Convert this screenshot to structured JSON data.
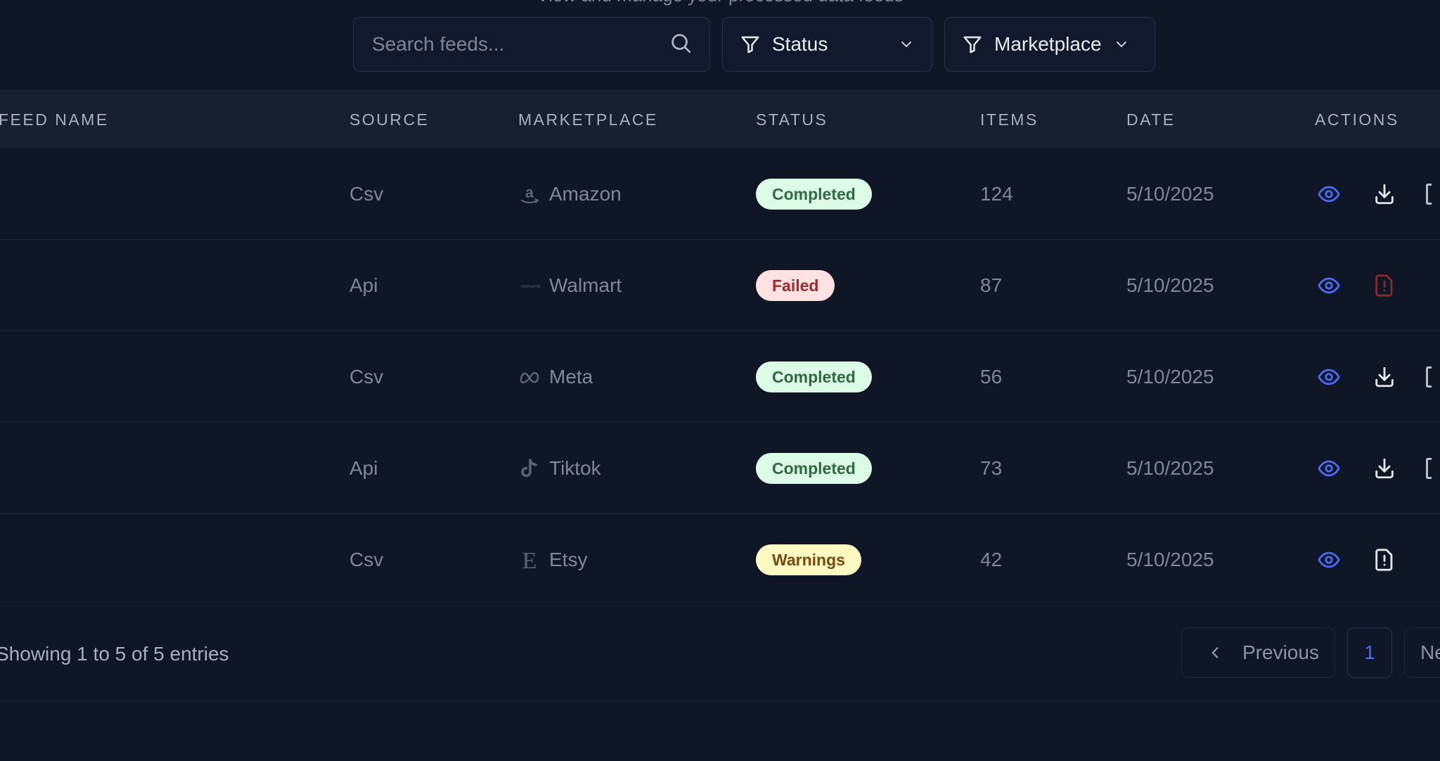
{
  "header": {
    "subtitle": "View and manage your processed data feeds"
  },
  "toolbar": {
    "search_placeholder": "Search feeds...",
    "status_filter": "Status",
    "marketplace_filter": "Marketplace"
  },
  "table": {
    "columns": [
      "FEED NAME",
      "SOURCE",
      "MARKETPLACE",
      "STATUS",
      "ITEMS",
      "DATE",
      "ACTIONS"
    ],
    "rows": [
      {
        "name": "",
        "source": "Csv",
        "marketplace": "Amazon",
        "marketplace_icon": "amazon-icon",
        "status": "Completed",
        "items": "124",
        "date": "5/10/2025",
        "secondary_action": "download"
      },
      {
        "name": "",
        "source": "Api",
        "marketplace": "Walmart",
        "marketplace_icon": "walmart-icon",
        "status": "Failed",
        "items": "87",
        "date": "5/10/2025",
        "secondary_action": "error-report"
      },
      {
        "name": "",
        "source": "Csv",
        "marketplace": "Meta",
        "marketplace_icon": "meta-icon",
        "status": "Completed",
        "items": "56",
        "date": "5/10/2025",
        "secondary_action": "download"
      },
      {
        "name": "",
        "source": "Api",
        "marketplace": "Tiktok",
        "marketplace_icon": "tiktok-icon",
        "status": "Completed",
        "items": "73",
        "date": "5/10/2025",
        "secondary_action": "download"
      },
      {
        "name": "",
        "source": "Csv",
        "marketplace": "Etsy",
        "marketplace_icon": "etsy-icon",
        "status": "Warnings",
        "items": "42",
        "date": "5/10/2025",
        "secondary_action": "warning-report"
      }
    ]
  },
  "status_colors": {
    "Completed": {
      "bg": "#dcfce7",
      "fg": "#2f6b3f"
    },
    "Failed": {
      "bg": "#fee2e2",
      "fg": "#a12a2a"
    },
    "Warnings": {
      "bg": "#fef9c3",
      "fg": "#7a4a12"
    }
  },
  "pagination": {
    "summary": "Showing 1 to 5 of 5 entries",
    "previous_label": "Previous",
    "current_page": "1",
    "next_label": "Next"
  },
  "colors": {
    "accent": "#4a6cf7",
    "background": "#0f1626",
    "header_bg": "#171f30"
  }
}
